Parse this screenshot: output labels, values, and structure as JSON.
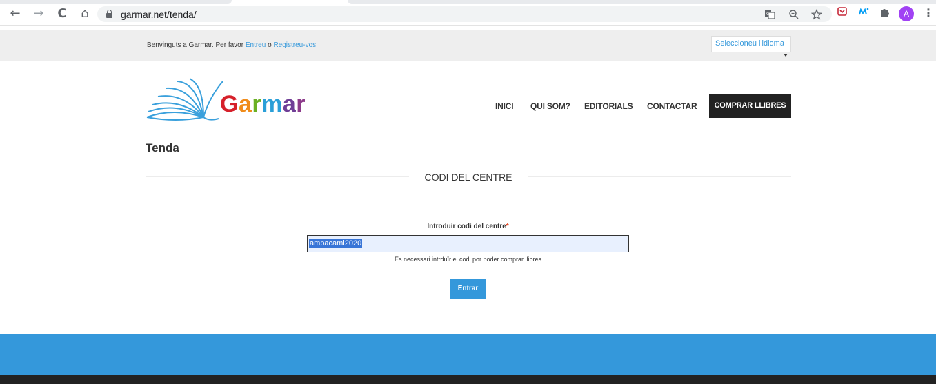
{
  "browser": {
    "url": "garmar.net/tenda/",
    "avatar_letter": "A",
    "back_glyph": "←",
    "forward_glyph": "→",
    "reload_glyph": "C",
    "home_glyph": "⌂",
    "kebab_glyph": "⋮"
  },
  "topbar": {
    "welcome_prefix": "Benvinguts a Garmar. Per favor ",
    "login_link": "Entreu",
    "connector": " o ",
    "register_link": "Registreu-vos",
    "language_select": "Seleccioneu l'idioma"
  },
  "header": {
    "logo": {
      "g": "G",
      "a": "a",
      "r": "r",
      "m": "m",
      "a2": "a",
      "r2": "r"
    },
    "nav": [
      {
        "label": "INICI"
      },
      {
        "label": "QUI SOM?"
      },
      {
        "label": "EDITORIALS"
      },
      {
        "label": "CONTACTAR"
      }
    ],
    "cta": "COMPRAR LLIBRES"
  },
  "main": {
    "page_title": "Tenda",
    "section_title": "CODI DEL CENTRE",
    "field_label": "Introduir codi del centre",
    "required_mark": "*",
    "field_value": "ampacami2020",
    "hint": "És necessari intrduïr el codi por poder comprar llibres",
    "submit": "Entrar"
  },
  "colors": {
    "accent": "#3498db",
    "dark": "#222222"
  }
}
